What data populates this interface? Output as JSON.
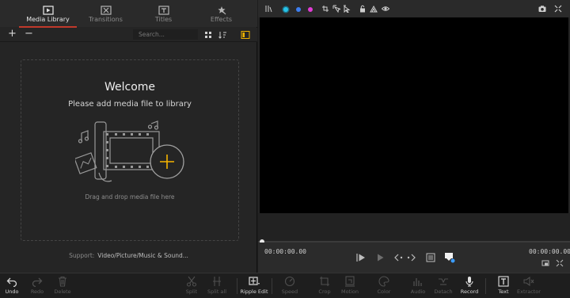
{
  "media_panel": {
    "tabs": [
      {
        "label": "Media Library",
        "icon": "media-library-icon",
        "active": true
      },
      {
        "label": "Transitions",
        "icon": "transitions-icon",
        "active": false
      },
      {
        "label": "Titles",
        "icon": "titles-icon",
        "active": false
      },
      {
        "label": "Effects",
        "icon": "effects-icon",
        "active": false
      }
    ],
    "add_label": "+",
    "remove_label": "−",
    "search_placeholder": "Search...",
    "welcome_title": "Welcome",
    "welcome_subtitle": "Please add media file to library",
    "drag_hint": "Drag and drop media file here",
    "support_label": "Support:",
    "support_value": "Video/Picture/Music & Sound..."
  },
  "player": {
    "toolbar_icons": [
      "compare-icon",
      "cyan-marker-icon",
      "blue-marker-icon",
      "magenta-marker-icon",
      "crop-select-icon",
      "transform-select-icon",
      "pointer-select-icon",
      "lock-icon",
      "volume-icon",
      "eye-icon",
      "snapshot-icon",
      "fullscreen-icon"
    ],
    "marker_colors": [
      "#27c3e8",
      "#3d7ff0",
      "#e23cd6"
    ],
    "current_time": "00:00:00.00",
    "total_time": "00:00:00.00"
  },
  "bottom_toolbar": [
    {
      "label": "Undo",
      "icon": "undo-icon",
      "enabled": true
    },
    {
      "label": "Redo",
      "icon": "redo-icon",
      "enabled": false
    },
    {
      "label": "Delete",
      "icon": "delete-icon",
      "enabled": false
    },
    {
      "label": "Split",
      "icon": "split-icon",
      "enabled": false
    },
    {
      "label": "Split all",
      "icon": "split-all-icon",
      "enabled": false
    },
    {
      "label": "Ripple Edit",
      "icon": "ripple-edit-icon",
      "enabled": true
    },
    {
      "label": "Speed",
      "icon": "speed-icon",
      "enabled": false
    },
    {
      "label": "Crop",
      "icon": "crop-icon",
      "enabled": false
    },
    {
      "label": "Motion",
      "icon": "motion-icon",
      "enabled": false
    },
    {
      "label": "Color",
      "icon": "color-icon",
      "enabled": false
    },
    {
      "label": "Audio",
      "icon": "audio-icon",
      "enabled": false
    },
    {
      "label": "Detach",
      "icon": "detach-icon",
      "enabled": false
    },
    {
      "label": "Record",
      "icon": "record-icon",
      "enabled": true
    },
    {
      "label": "Text",
      "icon": "text-icon",
      "enabled": true
    },
    {
      "label": "Extractor",
      "icon": "extractor-icon",
      "enabled": false
    }
  ],
  "colors": {
    "accent": "#c0392b",
    "plus_accent": "#f5b400"
  }
}
